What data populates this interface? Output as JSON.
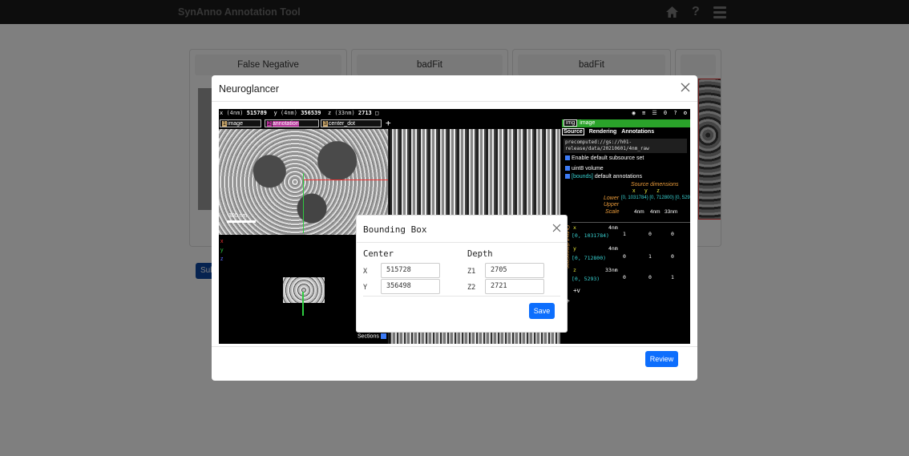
{
  "app": {
    "title": "SynAnno Annotation Tool"
  },
  "navbar": {
    "help_glyph": "?"
  },
  "cards": [
    {
      "title": "False Negative"
    },
    {
      "title": "badFit"
    },
    {
      "title": "badFit"
    },
    {
      "title": ""
    }
  ],
  "background": {
    "submit_label": "Sub"
  },
  "modal": {
    "title": "Neuroglancer",
    "review_label": "Review"
  },
  "neuroglancer": {
    "coords": {
      "x_label": "x",
      "x_unit": "(4nm)",
      "x_value": "515789",
      "y_label": "y",
      "y_unit": "(4nm)",
      "y_value": "356539",
      "z_label": "z",
      "z_unit": "(33nm)",
      "z_value": "2713"
    },
    "top_count": "0",
    "layers": [
      {
        "index": "1",
        "name": "image"
      },
      {
        "index": "2",
        "name": "annotation"
      },
      {
        "index": "3",
        "name": "center_dot"
      }
    ],
    "add_layer": "+",
    "scalebar": "300 nm",
    "axes": [
      "x",
      "y",
      "z"
    ],
    "sections_label": "Sections",
    "side_panel": {
      "layer_type": "img",
      "layer_name": "image",
      "tabs": [
        "Source",
        "Rendering",
        "Annotations"
      ],
      "source_url": "precomputed://gs://h01-release/data/20210601/4nm_raw",
      "checkboxes": [
        "Enable default subsource set",
        "uint8 volume",
        "[bounds]",
        "default annotations"
      ],
      "source_dimensions_label": "Source dimensions",
      "dim_headers": [
        "x",
        "y",
        "z"
      ],
      "lower_label": "Lower",
      "upper_label": "Upper",
      "scale_label": "Scale",
      "bounds": [
        "[0, 1031784)",
        "[0, 712800)",
        "[0, 5293)"
      ],
      "scales": [
        "4nm",
        "4nm",
        "33nm"
      ],
      "output_dimensions_label": "Output dimensions",
      "matrix": [
        [
          "1",
          "0",
          "0"
        ],
        [
          "0",
          "1",
          "0"
        ],
        [
          "0",
          "0",
          "1"
        ]
      ],
      "add_dim": "+v"
    }
  },
  "bounding_box": {
    "title": "Bounding Box",
    "center_label": "Center",
    "depth_label": "Depth",
    "x_label": "X",
    "x_value": "515728",
    "y_label": "Y",
    "y_value": "356498",
    "z1_label": "Z1",
    "z1_value": "2705",
    "z2_label": "Z2",
    "z2_value": "2721",
    "save_label": "Save"
  },
  "colors": {
    "navbar": "#1a1a1a",
    "primary": "#0d6efd",
    "layer_panel_green": "#2aa22a",
    "annotation_magenta": "#b8339b"
  }
}
